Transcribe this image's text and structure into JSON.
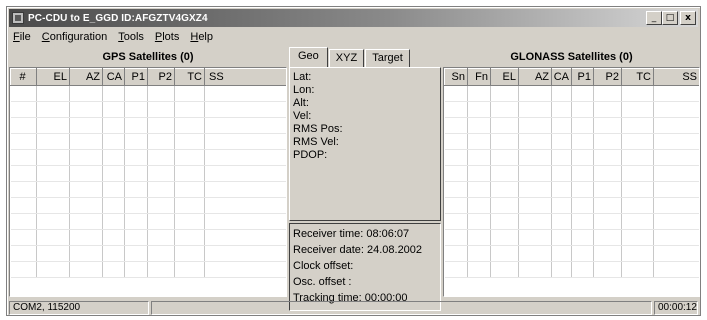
{
  "window": {
    "title": "PC-CDU to E_GGD ID:AFGZTV4GXZ4",
    "buttons": {
      "minimize": "_",
      "maximize": "□",
      "close": "x"
    }
  },
  "menu": [
    {
      "label": "File",
      "underline": "F"
    },
    {
      "label": "Configuration",
      "underline": "C"
    },
    {
      "label": "Tools",
      "underline": "T"
    },
    {
      "label": "Plots",
      "underline": "P"
    },
    {
      "label": "Help",
      "underline": "H"
    }
  ],
  "gps": {
    "title": "GPS Satellites (0)",
    "columns": [
      "#",
      "EL",
      "AZ",
      "CA",
      "P1",
      "P2",
      "TC",
      "SS"
    ]
  },
  "glonass": {
    "title": "GLONASS Satellites (0)",
    "columns": [
      "Sn",
      "Fn",
      "EL",
      "AZ",
      "CA",
      "P1",
      "P2",
      "TC",
      "SS"
    ]
  },
  "tabs": [
    "Geo",
    "XYZ",
    "Target"
  ],
  "active_tab": "Geo",
  "geo": {
    "lat": "Lat:",
    "lon": "Lon:",
    "alt": "Alt:",
    "vel": "Vel:",
    "rms_pos": "RMS Pos:",
    "rms_vel": "RMS Vel:",
    "pdop": "PDOP:"
  },
  "info": {
    "receiver_time": "Receiver time: 08:06:07",
    "receiver_date": "Receiver date: 24.08.2002",
    "clock_offset": "Clock offset:",
    "osc_offset": "Osc. offset :",
    "tracking_time": "Tracking time: 00:00:00"
  },
  "status": {
    "port": "COM2, 115200",
    "middle": "",
    "elapsed": "00:00:12"
  }
}
